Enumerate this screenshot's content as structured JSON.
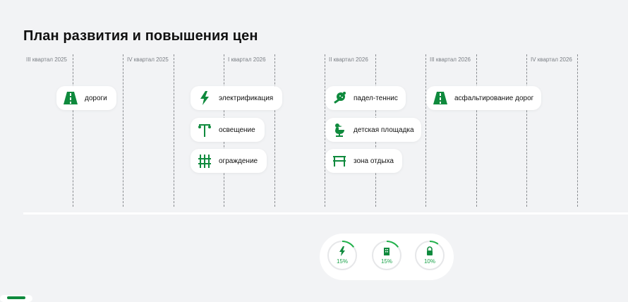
{
  "page": {
    "title": "План развития и повышения цен"
  },
  "timeline": {
    "quarters": [
      "III квартал 2025",
      "IV квартал 2025",
      "I квартал 2026",
      "II квартал 2026",
      "III квартал 2026",
      "IV квартал 2026"
    ],
    "cards": [
      {
        "label": "дороги",
        "icon": "road-icon"
      },
      {
        "label": "электрификация",
        "icon": "lightning-icon"
      },
      {
        "label": "освещение",
        "icon": "street-lamp-icon"
      },
      {
        "label": "ограждение",
        "icon": "fence-icon"
      },
      {
        "label": "падел-теннис",
        "icon": "paddle-tennis-icon"
      },
      {
        "label": "детская площадка",
        "icon": "playground-duck-icon"
      },
      {
        "label": "зона отдыха",
        "icon": "bench-icon"
      },
      {
        "label": "асфальтирование дорог",
        "icon": "road-icon"
      }
    ]
  },
  "stats": [
    {
      "label": "15%",
      "value": 0.15,
      "icon": "lightning-icon"
    },
    {
      "label": "15%",
      "value": 0.15,
      "icon": "building-icon"
    },
    {
      "label": "10%",
      "value": 0.1,
      "icon": "lock-icon"
    }
  ],
  "colors": {
    "accent": "#0f8a3d",
    "ring_track": "#e6e7e9",
    "ring_fill": "#22b24c",
    "background": "#f2f3f5"
  }
}
